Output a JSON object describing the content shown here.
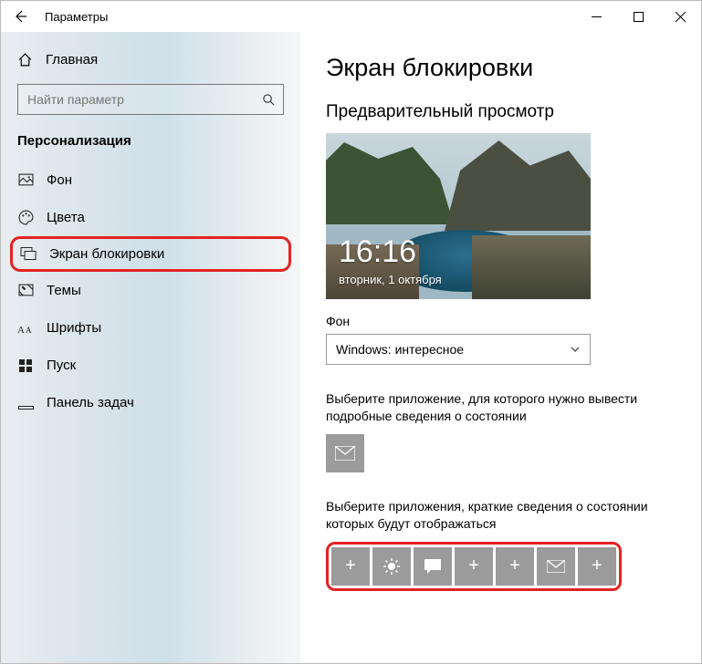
{
  "window": {
    "title": "Параметры"
  },
  "sidebar": {
    "home": "Главная",
    "search_placeholder": "Найти параметр",
    "section": "Персонализация",
    "items": [
      {
        "label": "Фон"
      },
      {
        "label": "Цвета"
      },
      {
        "label": "Экран блокировки"
      },
      {
        "label": "Темы"
      },
      {
        "label": "Шрифты"
      },
      {
        "label": "Пуск"
      },
      {
        "label": "Панель задач"
      }
    ]
  },
  "main": {
    "title": "Экран блокировки",
    "preview_label": "Предварительный просмотр",
    "preview": {
      "time": "16:16",
      "date": "вторник, 1 октября"
    },
    "bg_label": "Фон",
    "bg_select": "Windows: интересное",
    "detail_app_text": "Выберите приложение, для которого нужно вывести подробные сведения о состоянии",
    "quick_apps_text": "Выберите приложения, краткие сведения о состоянии которых будут отображаться"
  }
}
